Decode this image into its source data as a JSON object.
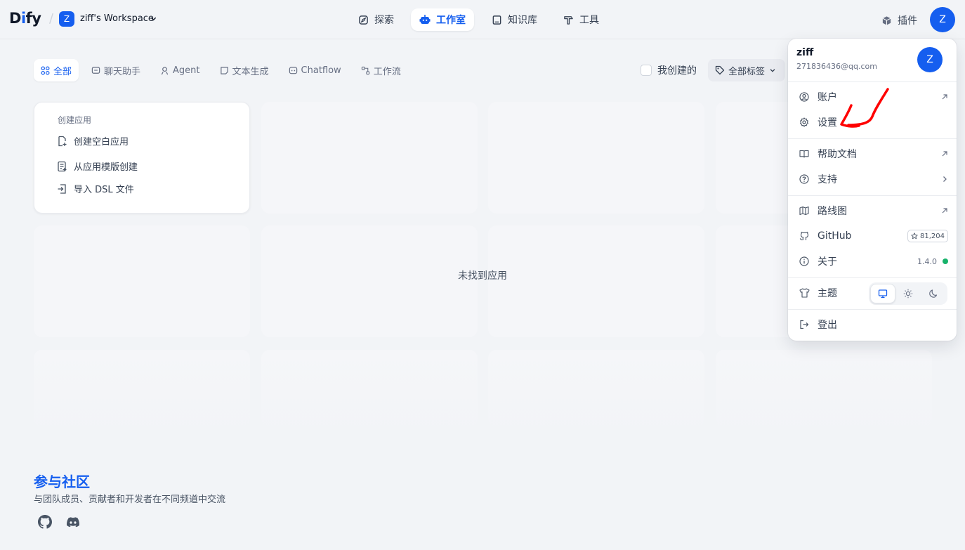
{
  "header": {
    "logo_prefix": "D",
    "logo_mid": "i",
    "logo_suffix": "fy",
    "workspace_initial": "Z",
    "workspace_name": "ziff's Workspace",
    "nav": [
      {
        "label": "探索",
        "icon": "compass-icon"
      },
      {
        "label": "工作室",
        "icon": "robot-icon"
      },
      {
        "label": "知识库",
        "icon": "book-icon"
      },
      {
        "label": "工具",
        "icon": "hammer-icon"
      }
    ],
    "plugin_label": "插件",
    "avatar_initial": "Z"
  },
  "filters": {
    "tabs": [
      {
        "label": "全部",
        "icon": "grid-icon"
      },
      {
        "label": "聊天助手",
        "icon": "chat-icon"
      },
      {
        "label": "Agent",
        "icon": "agent-icon"
      },
      {
        "label": "文本生成",
        "icon": "note-icon"
      },
      {
        "label": "Chatflow",
        "icon": "chatflow-icon"
      },
      {
        "label": "工作流",
        "icon": "workflow-icon"
      }
    ],
    "mine_label": "我创建的",
    "tag_label": "全部标签"
  },
  "create_card": {
    "title": "创建应用",
    "items": [
      {
        "label": "创建空白应用",
        "icon": "file-plus-icon"
      },
      {
        "label": "从应用模版创建",
        "icon": "template-icon"
      },
      {
        "label": "导入 DSL 文件",
        "icon": "import-icon"
      }
    ]
  },
  "empty_text": "未找到应用",
  "community": {
    "title": "参与社区",
    "subtitle": "与团队成员、贡献者和开发者在不同频道中交流"
  },
  "menu": {
    "user_name": "ziff",
    "email": "271836436@qq.com",
    "avatar_initial": "Z",
    "account_label": "账户",
    "settings_label": "设置",
    "docs_label": "帮助文档",
    "support_label": "支持",
    "roadmap_label": "路线图",
    "github_label": "GitHub",
    "github_stars": "81,204",
    "about_label": "关于",
    "version": "1.4.0",
    "theme_label": "主题",
    "logout_label": "登出"
  },
  "colors": {
    "accent": "#155eef",
    "background": "#f2f4f7",
    "status_green": "#17b26a",
    "annotation_red": "#ff0000"
  }
}
